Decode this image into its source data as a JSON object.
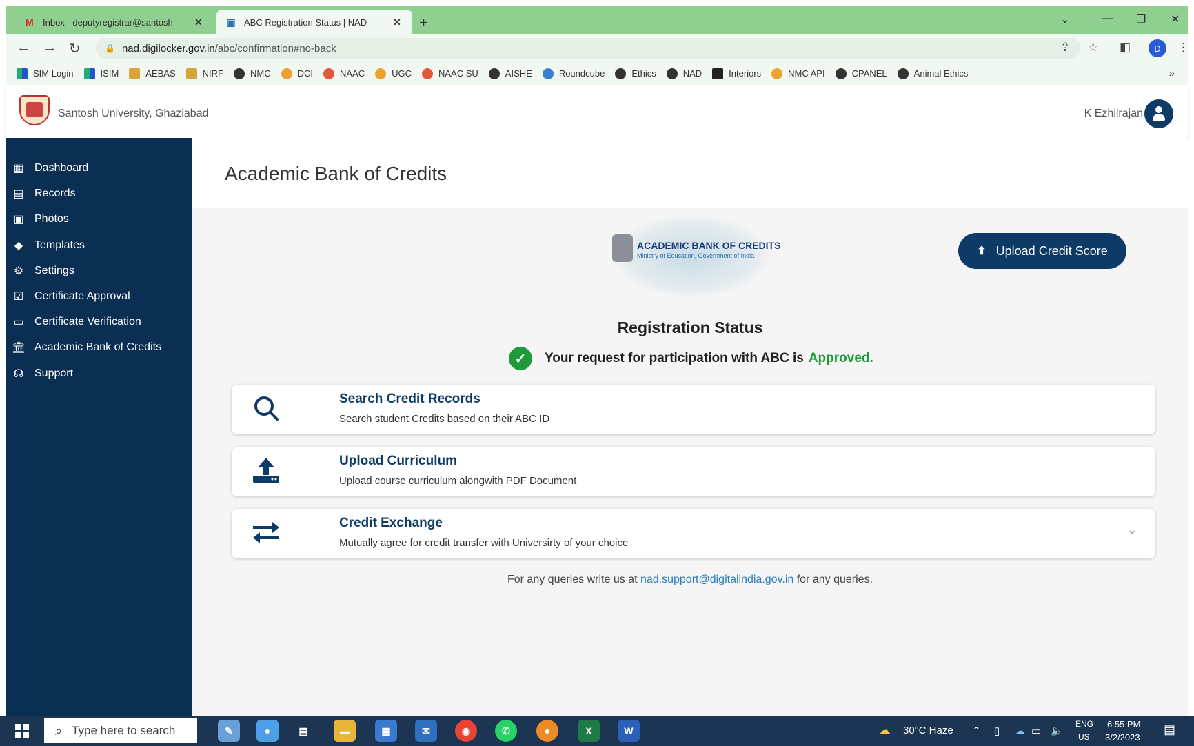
{
  "browser": {
    "tabs": [
      {
        "title": "Inbox - deputyregistrar@santosh",
        "favicon": "gmail-icon",
        "active": false
      },
      {
        "title": "ABC Registration Status | NAD",
        "favicon": "nad-icon",
        "active": true
      }
    ],
    "url": {
      "host": "nad.digilocker.gov.in",
      "path": "/abc/confirmation#no-back"
    },
    "profile_initial": "D",
    "bookmarks": [
      "SIM Login",
      "ISIM",
      "AEBAS",
      "NIRF",
      "NMC",
      "DCI",
      "NAAC",
      "UGC",
      "NAAC SU",
      "AISHE",
      "Roundcube",
      "Ethics",
      "NAD",
      "Interiors",
      "NMC API",
      "CPANEL",
      "Animal Ethics"
    ],
    "bookmarks_more": "»"
  },
  "header": {
    "university": "Santosh University, Ghaziabad",
    "user": "K Ezhilrajan"
  },
  "sidebar": {
    "items": [
      {
        "label": "Dashboard",
        "icon": "dashboard-icon"
      },
      {
        "label": "Records",
        "icon": "file-icon"
      },
      {
        "label": "Photos",
        "icon": "photos-icon"
      },
      {
        "label": "Templates",
        "icon": "tag-icon"
      },
      {
        "label": "Settings",
        "icon": "gear-icon"
      },
      {
        "label": "Certificate Approval",
        "icon": "approval-icon"
      },
      {
        "label": "Certificate Verification",
        "icon": "verification-icon"
      },
      {
        "label": "Academic Bank of Credits",
        "icon": "bank-icon"
      },
      {
        "label": "Support",
        "icon": "headset-icon"
      }
    ]
  },
  "main": {
    "page_title": "Academic Bank of Credits",
    "abc_logo": {
      "title": "ACADEMIC BANK OF CREDITS",
      "subtitle": "Ministry of Education, Government of India"
    },
    "upload_button": "Upload Credit Score",
    "registration_title": "Registration Status",
    "status_text": "Your request for participation with ABC is",
    "status_value": "Approved.",
    "cards": [
      {
        "title": "Search Credit Records",
        "desc": "Search student Credits based on their ABC ID",
        "icon": "search-icon"
      },
      {
        "title": "Upload Curriculum",
        "desc": "Upload course curriculum alongwith PDF Document",
        "icon": "upload-icon"
      },
      {
        "title": "Credit Exchange",
        "desc": "Mutually agree for credit transfer with Universirty of your choice",
        "icon": "exchange-icon"
      }
    ],
    "footer": {
      "pre": "For any queries write us at",
      "email": "nad.support@digitalindia.gov.in",
      "post": "for any queries."
    }
  },
  "taskbar": {
    "search_placeholder": "Type here to search",
    "weather": "30°C Haze",
    "lang": "ENG",
    "region": "US",
    "time": "6:55 PM",
    "date": "3/2/2023"
  },
  "colors": {
    "sidebar": "#0b2f52",
    "primary": "#0d3b66",
    "success": "#1f9a3a",
    "tabbar": "#8fcf8f"
  }
}
